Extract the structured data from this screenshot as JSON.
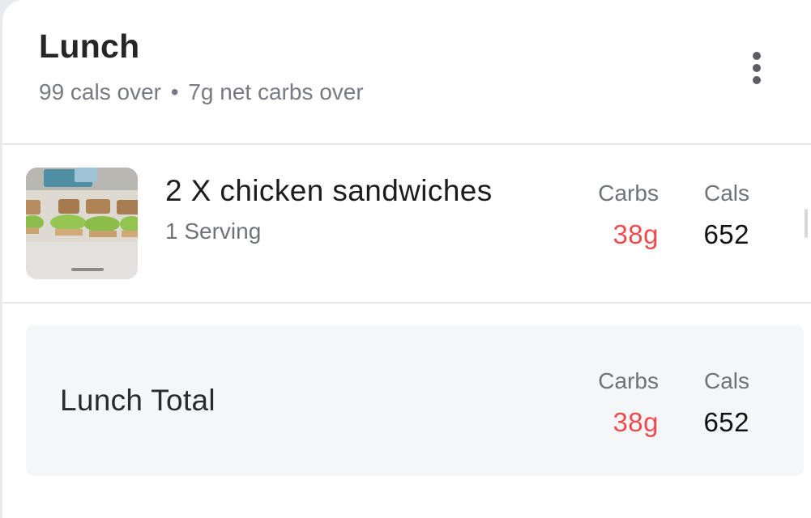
{
  "meal": {
    "title": "Lunch",
    "summary_cals": "99 cals over",
    "summary_separator": "•",
    "summary_carbs": "7g net carbs over",
    "more_icon": "more-vertical-icon"
  },
  "food_items": [
    {
      "name": "2 X chicken sandwiches",
      "serving": "1 Serving",
      "carbs_label": "Carbs",
      "carbs_value": "38g",
      "cals_label": "Cals",
      "cals_value": "652",
      "thumbnail": "sandwiches-photo"
    }
  ],
  "total": {
    "label": "Lunch Total",
    "carbs_label": "Carbs",
    "carbs_value": "38g",
    "cals_label": "Cals",
    "cals_value": "652"
  },
  "colors": {
    "over_accent": "#ef4b4f",
    "card_bg": "#ffffff",
    "total_bg": "#f5f6f8"
  }
}
